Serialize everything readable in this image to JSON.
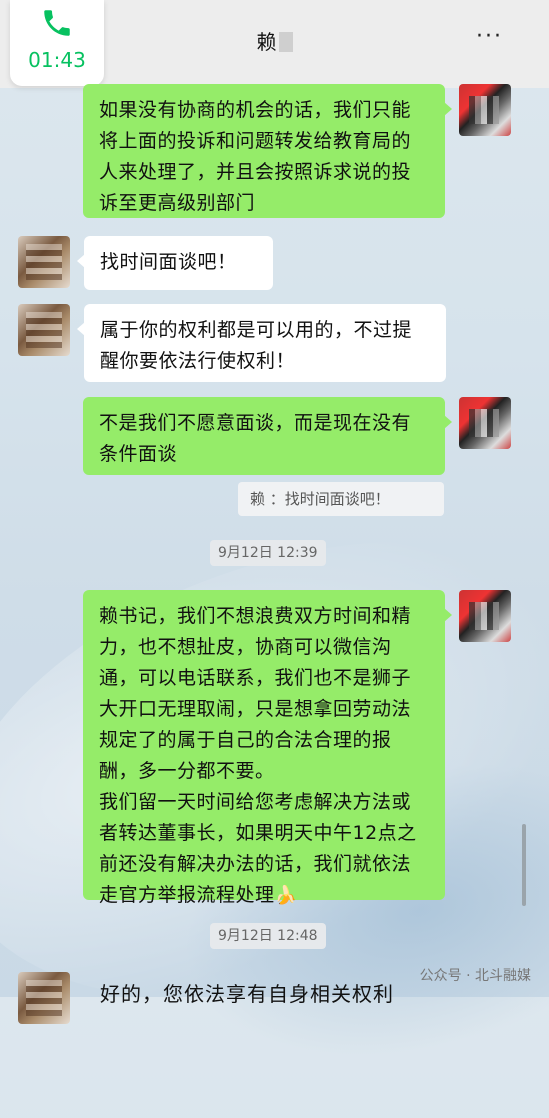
{
  "call": {
    "icon": "phone-icon",
    "duration": "01:43"
  },
  "header": {
    "title": "赖",
    "more": "···"
  },
  "messages": {
    "m1": "如果没有协商的机会的话，我们只能将上面的投诉和问题转发给教育局的人来处理了，并且会按照诉求说的投诉至更高级别部门",
    "m2": "找时间面谈吧！",
    "m3": "属于你的权利都是可以用的，不过提醒你要依法行使权利！",
    "m4": "不是我们不愿意面谈，而是现在没有条件面谈",
    "quote": "赖    ：找时间面谈吧！",
    "ts1": "9月12日 12:39",
    "m5a": "赖书记，我们不想浪费双方时间和精力，也不想扯皮，协商可以微信沟通，可以电话联系，我们也不是狮子大开口无理取闹，只是想拿回劳动法规定了的属于自己的合法合理的报酬，多一分都不要。",
    "m5b": "我们留一天时间给您考虑解决方法或者转达董事长，如果明天中午12点之前还没有解决办法的话，我们就依法走官方举报流程处理",
    "ts2": "9月12日 12:48",
    "m6_partial": "好的，您依法享有自身相关权利"
  },
  "watermark": "公众号 · 北斗融媒",
  "colors": {
    "green_bubble": "#95ec69",
    "accent": "#07c160"
  }
}
